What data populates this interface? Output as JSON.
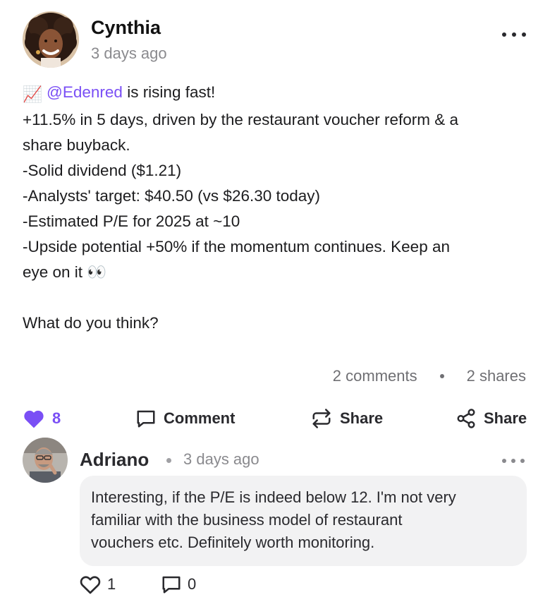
{
  "post": {
    "author": "Cynthia",
    "time": "3 days ago",
    "emoji": "📈",
    "mention": "@Edenred",
    "first_line_rest": " is rising fast!",
    "lines": [
      "+11.5% in 5 days, driven by the restaurant voucher reform & a",
      "share buyback.",
      "-Solid dividend ($1.21)",
      "-Analysts' target: $40.50 (vs $26.30 today)",
      "-Estimated P/E for 2025 at ~10",
      "-Upside potential +50% if the momentum continues. Keep an",
      "eye on it 👀",
      "",
      "What do you think?"
    ],
    "comments_count": "2 comments",
    "shares_count": "2 shares",
    "likes": "8",
    "actions": {
      "comment": "Comment",
      "repost": "Share",
      "share": "Share"
    },
    "like_color": "#7a4ff5"
  },
  "comment": {
    "author": "Adriano",
    "time": "3 days ago",
    "lines": [
      "Interesting, if the P/E is indeed below 12. I'm not very",
      "familiar with the business model of restaurant",
      "vouchers etc. Definitely worth monitoring."
    ],
    "likes": "1",
    "replies": "0"
  }
}
